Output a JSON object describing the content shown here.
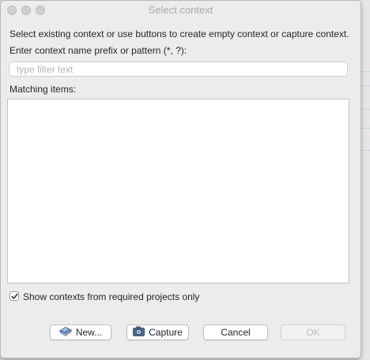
{
  "dialog": {
    "title": "Select context",
    "instruction": "Select existing context or use buttons to create empty context or capture context.",
    "filter_label": "Enter context name prefix or pattern (*, ?):",
    "filter_placeholder": "type filter text",
    "filter_value": "",
    "matching_label": "Matching items:",
    "matching_items": [],
    "checkbox_label": "Show contexts from required projects only",
    "checkbox_checked": true
  },
  "buttons": {
    "new_label": "New...",
    "capture_label": "Capture",
    "cancel_label": "Cancel",
    "ok_label": "OK",
    "ok_enabled": false
  },
  "icons": {
    "new": "book-icon",
    "capture": "camera-icon"
  }
}
